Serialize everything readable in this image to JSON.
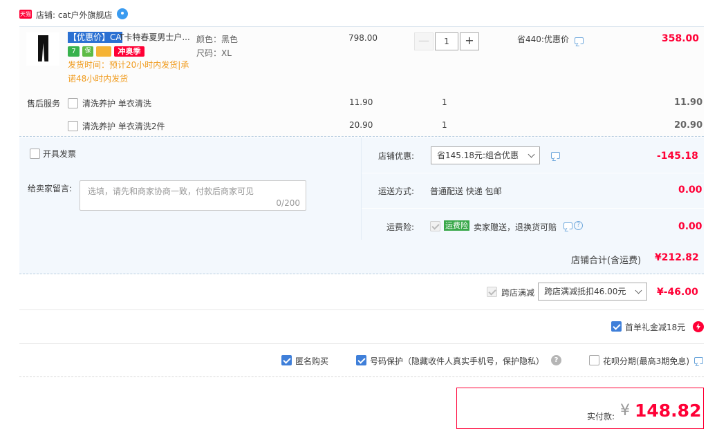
{
  "shop": {
    "badge": "天猫",
    "label": "店铺: cat户外旗舰店"
  },
  "item": {
    "title_highlight": "【优惠价】CA",
    "title_rest": "T卡特春夏男士户...",
    "tags": {
      "seven": "7",
      "b": "保",
      "promo": "冲奥季"
    },
    "shipping": "发货时间：预计20小时内发货|承诺48小时内发货",
    "color": "颜色：黑色",
    "size": "尺码：XL",
    "price": "798.00",
    "qty": "1",
    "minus": "—",
    "plus": "+",
    "saving": "省440:优惠价",
    "amount": "358.00"
  },
  "services": {
    "label": "售后服务",
    "rows": [
      {
        "name": "清洗养护 单衣清洗",
        "price": "11.90",
        "qty": "1",
        "amount": "11.90"
      },
      {
        "name": "清洗养护 单衣清洗2件",
        "price": "20.90",
        "qty": "1",
        "amount": "20.90"
      }
    ]
  },
  "invoice": {
    "label": "开具发票"
  },
  "memo": {
    "label": "给卖家留言:",
    "placeholder": "选填，请先和商家协商一致，付款后商家可见",
    "counter": "0/200"
  },
  "shop_discount": {
    "label": "店铺优惠:",
    "selected": "省145.18元:组合优惠",
    "amount": "-145.18"
  },
  "delivery": {
    "label": "运送方式:",
    "value": "普通配送 快递 包邮",
    "amount": "0.00"
  },
  "insurance": {
    "label": "运费险:",
    "badge": "运费险",
    "value": "卖家赠送，退换货可赔",
    "amount": "0.00"
  },
  "shop_total": {
    "label": "店铺合计(含运费)",
    "amount": "¥212.82"
  },
  "cross_store": {
    "label": "跨店满减",
    "selected": "跨店满减抵扣46.00元",
    "amount": "¥-46.00"
  },
  "first_order": {
    "label": "首单礼金减18元"
  },
  "options": {
    "anonymous": "匿名购买",
    "number_protect": "号码保护（隐藏收件人真实手机号，保护隐私）",
    "help": "?",
    "huabei": "花呗分期(最高3期免息)"
  },
  "payment": {
    "label": "实付款:",
    "currency": "¥",
    "amount": "148.82"
  },
  "colors": {
    "accent_red": "#ff0036",
    "link_blue": "#3f7fd9",
    "panel_bg": "#f3f8fd",
    "ship_orange": "#f09b1d"
  }
}
